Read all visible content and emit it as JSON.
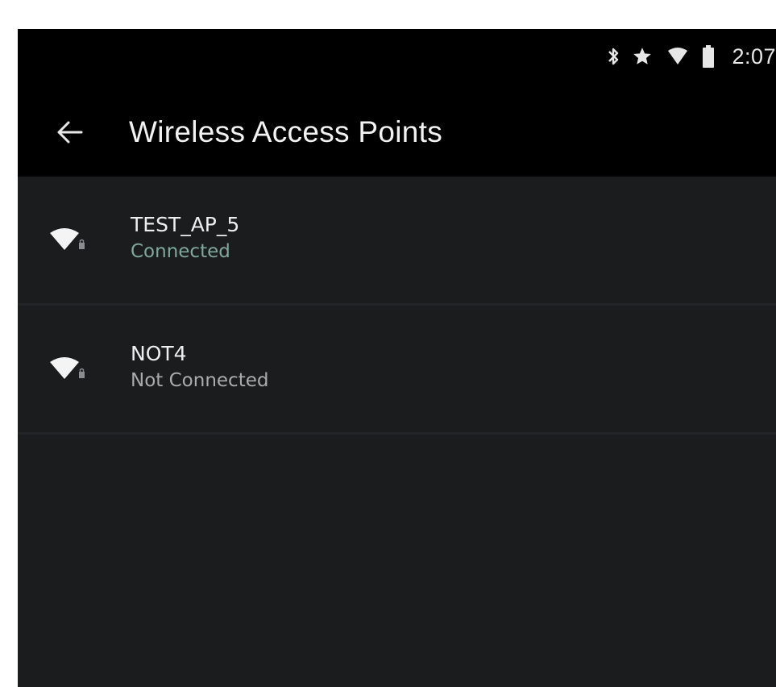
{
  "status_bar": {
    "icons": [
      "bluetooth-icon",
      "star-icon",
      "wifi-signal-icon",
      "battery-icon"
    ],
    "time": "2:07"
  },
  "app_bar": {
    "back_icon": "arrow-left-icon",
    "title": "Wireless Access Points"
  },
  "access_points": [
    {
      "name": "TEST_AP_5",
      "status": "Connected",
      "status_color": "#7fa89a",
      "icon": "wifi-lock-icon"
    },
    {
      "name": "NOT4",
      "status": "Not Connected",
      "status_color": "#a9abad",
      "icon": "wifi-lock-icon"
    }
  ],
  "colors": {
    "background": "#1b1c1e",
    "header": "#000000",
    "divider": "#222427",
    "text_primary": "#eeeeee"
  }
}
